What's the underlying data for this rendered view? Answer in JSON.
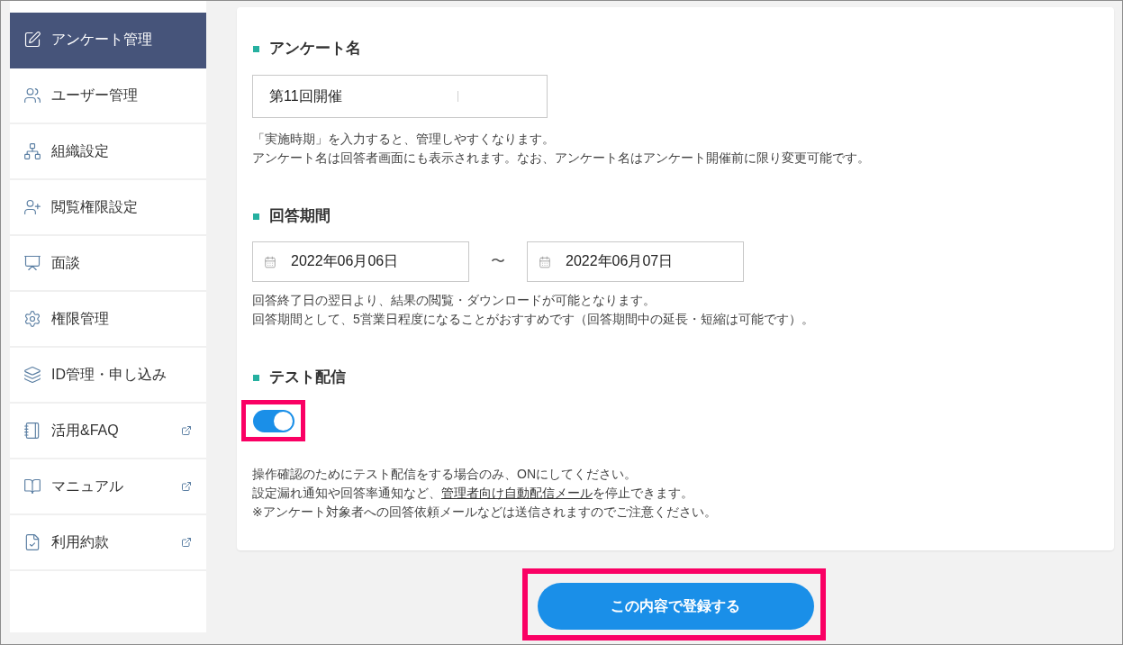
{
  "sidebar": {
    "items": [
      {
        "label": "アンケート管理",
        "selected": true,
        "external": false
      },
      {
        "label": "ユーザー管理",
        "selected": false,
        "external": false
      },
      {
        "label": "組織設定",
        "selected": false,
        "external": false
      },
      {
        "label": "閲覧権限設定",
        "selected": false,
        "external": false
      },
      {
        "label": "面談",
        "selected": false,
        "external": false
      },
      {
        "label": "権限管理",
        "selected": false,
        "external": false
      },
      {
        "label": "ID管理・申し込み",
        "selected": false,
        "external": false
      },
      {
        "label": "活用&FAQ",
        "selected": false,
        "external": true
      },
      {
        "label": "マニュアル",
        "selected": false,
        "external": true
      },
      {
        "label": "利用約款",
        "selected": false,
        "external": true
      }
    ]
  },
  "sections": [
    {
      "kind": "text-input",
      "heading": "アンケート名",
      "value": "第11回開催",
      "notes": [
        [
          {
            "kind": "text",
            "text": "「実施時期」を入力すると、管理しやすくなります。"
          }
        ],
        [
          {
            "kind": "text",
            "text": "アンケート名は回答者画面にも表示されます。なお、アンケート名はアンケート開催前に限り変更可能です。"
          }
        ]
      ]
    },
    {
      "kind": "date-range",
      "heading": "回答期間",
      "start": "2022年06月06日",
      "separator": "〜",
      "end": "2022年06月07日",
      "notes": [
        [
          {
            "kind": "text",
            "text": "回答終了日の翌日より、結果の閲覧・ダウンロードが可能となります。"
          }
        ],
        [
          {
            "kind": "text",
            "text": "回答期間として、5営業日程度になることがおすすめです（回答期間中の延長・短縮は可能です）。"
          }
        ]
      ]
    },
    {
      "kind": "toggle",
      "heading": "テスト配信",
      "on": true,
      "highlighted": true,
      "notes": [
        [
          {
            "kind": "text",
            "text": "操作確認のためにテスト配信をする場合のみ、ONにしてください。"
          }
        ],
        [
          {
            "kind": "text",
            "text": "設定漏れ通知や回答率通知など、"
          },
          {
            "kind": "link",
            "text": "管理者向け自動配信メール"
          },
          {
            "kind": "text",
            "text": "を停止できます。"
          }
        ],
        [
          {
            "kind": "text",
            "text": "※アンケート対象者への回答依頼メールなどは送信されますのでご注意ください。"
          }
        ]
      ]
    }
  ],
  "submit_button": {
    "label": "この内容で登録する",
    "highlighted": true
  }
}
